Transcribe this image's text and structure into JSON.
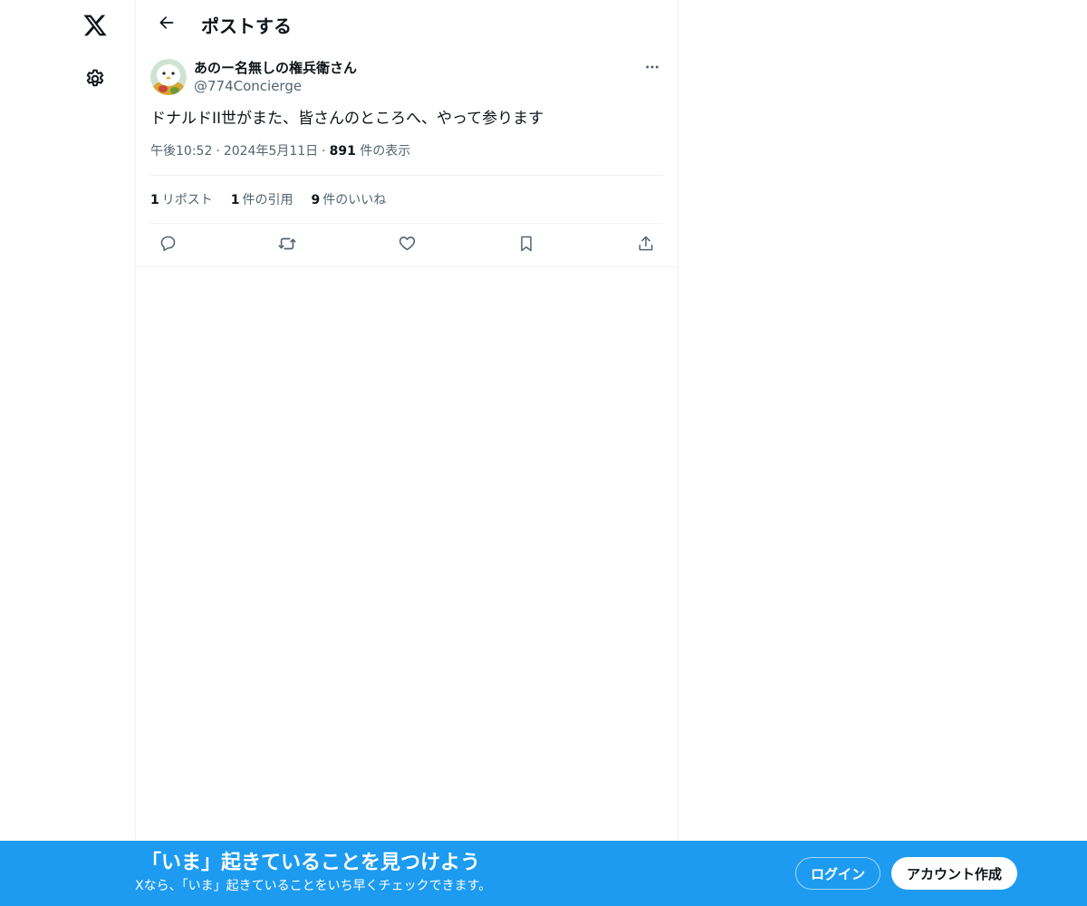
{
  "nav": {
    "logo_icon": "x-logo-icon",
    "settings_icon": "gear-icon"
  },
  "header": {
    "back_icon": "arrow-left-icon",
    "title": "ポストする"
  },
  "post": {
    "author_name": "あのー名無しの権兵衛さん",
    "author_handle": "@774Concierge",
    "text": "ドナルドII世がまた、皆さんのところへ、やって参ります",
    "time": "午後10:52",
    "date": "2024年5月11日",
    "views_count": "891",
    "views_label": "件の表示",
    "separator": "·"
  },
  "stats": {
    "reposts_count": "1",
    "reposts_label": "リポスト",
    "quotes_count": "1",
    "quotes_label": "件の引用",
    "likes_count": "9",
    "likes_label": "件のいいね"
  },
  "actions": [
    "reply-icon",
    "repost-icon",
    "like-icon",
    "bookmark-icon",
    "share-icon"
  ],
  "banner": {
    "title": "「いま」起きていることを見つけよう",
    "subtitle": "Xなら、「いま」起きていることをいち早くチェックできます。",
    "login_label": "ログイン",
    "signup_label": "アカウント作成"
  },
  "colors": {
    "accent": "#1d9bf0",
    "text_primary": "#0f1419",
    "text_secondary": "#536471",
    "border": "#eff3f4"
  }
}
